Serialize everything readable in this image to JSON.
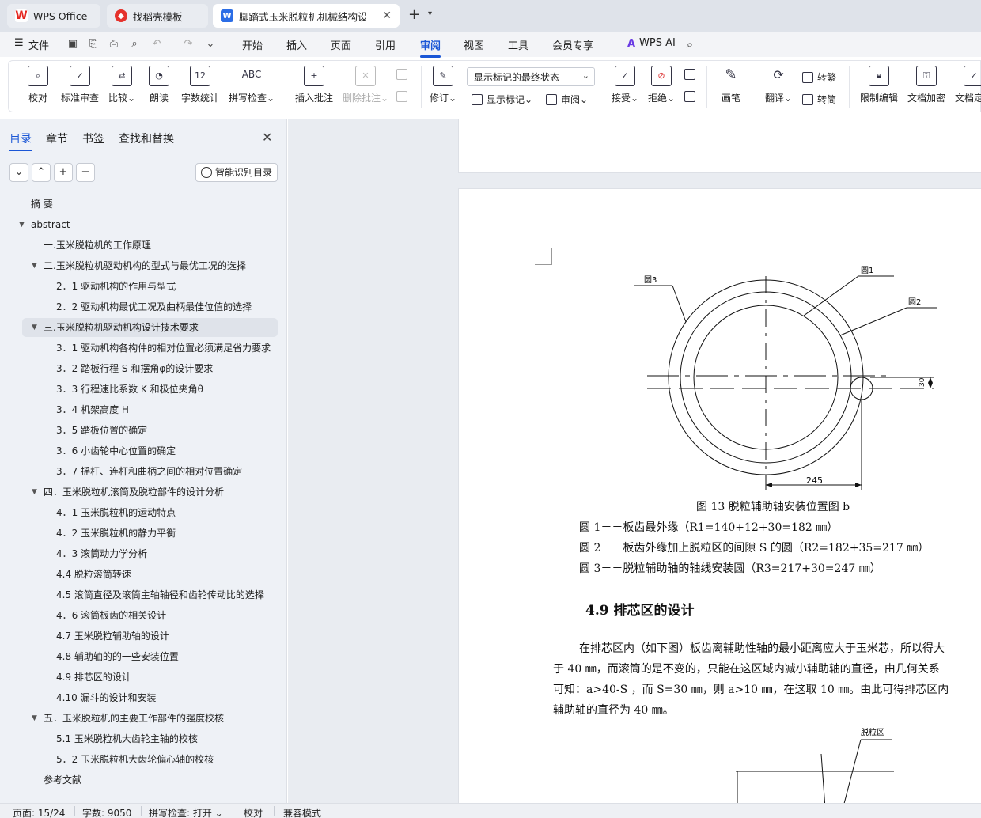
{
  "titlebar": {
    "tabs": [
      {
        "label": "WPS Office"
      },
      {
        "label": "找稻壳模板"
      },
      {
        "label": "脚踏式玉米脱粒机机械结构设计"
      }
    ],
    "new_tab": "+",
    "tab_list": "⌄"
  },
  "menubar": {
    "file": "文件",
    "items": [
      "开始",
      "插入",
      "页面",
      "引用",
      "审阅",
      "视图",
      "工具",
      "会员专享"
    ],
    "active": "审阅",
    "wps_ai": "WPS AI"
  },
  "ribbon": {
    "proofread": "校对",
    "std_review": "标准审查",
    "compare": "比较",
    "read_aloud": "朗读",
    "word_count": "字数统计",
    "spell_check": "拼写检查",
    "insert_comment": "插入批注",
    "delete_comment": "删除批注",
    "revise": "修订",
    "markup_state": "显示标记的最终状态",
    "show_markup": "显示标记",
    "review": "审阅",
    "accept": "接受",
    "reject": "拒绝",
    "pen": "画笔",
    "translate": "翻译",
    "to_traditional": "转繁",
    "to_simplified": "转简",
    "restrict_edit": "限制编辑",
    "doc_encrypt": "文档加密",
    "doc_final": "文档定稿",
    "word_count_icon_text": "12",
    "spell_icon_text": "ABC"
  },
  "nav": {
    "tabs": [
      "目录",
      "章节",
      "书签",
      "查找和替换"
    ],
    "ai_toc": "智能识别目录",
    "toc": [
      {
        "text": "摘  要",
        "level": 0,
        "arrow": ""
      },
      {
        "text": "abstract",
        "level": 0,
        "arrow": "▼"
      },
      {
        "text": "一.玉米脱粒机的工作原理",
        "level": 1,
        "arrow": ""
      },
      {
        "text": "二.玉米脱粒机驱动机构的型式与最优工况的选择",
        "level": 1,
        "arrow": "▼"
      },
      {
        "text": "2．1   驱动机构的作用与型式",
        "level": 2,
        "arrow": ""
      },
      {
        "text": "2．2   驱动机构最优工况及曲柄最佳位值的选择",
        "level": 2,
        "arrow": ""
      },
      {
        "text": "三.玉米脱粒机驱动机构设计技术要求",
        "level": 1,
        "arrow": "▼",
        "selected": true
      },
      {
        "text": "3．1   驱动机构各构件的相对位置必须满足省力要求",
        "level": 2,
        "arrow": ""
      },
      {
        "text": "3．2 踏板行程 S 和摆角φ的设计要求",
        "level": 2,
        "arrow": ""
      },
      {
        "text": "3．3 行程速比系数 K 和极位夹角θ",
        "level": 2,
        "arrow": ""
      },
      {
        "text": "3．4   机架高度 H",
        "level": 2,
        "arrow": ""
      },
      {
        "text": "3．5 踏板位置的确定",
        "level": 2,
        "arrow": ""
      },
      {
        "text": "3．6 小齿轮中心位置的确定",
        "level": 2,
        "arrow": ""
      },
      {
        "text": "3．7       摇杆、连杆和曲柄之间的相对位置确定",
        "level": 2,
        "arrow": ""
      },
      {
        "text": "四．玉米脱粒机滚筒及脱粒部件的设计分析",
        "level": 1,
        "arrow": "▼"
      },
      {
        "text": "4．1   玉米脱粒机的运动特点",
        "level": 2,
        "arrow": ""
      },
      {
        "text": "4．2 玉米脱粒机的静力平衡",
        "level": 2,
        "arrow": ""
      },
      {
        "text": "4．3   滚筒动力学分析",
        "level": 2,
        "arrow": ""
      },
      {
        "text": "4.4 脱粒滚筒转速",
        "level": 2,
        "arrow": ""
      },
      {
        "text": "4.5    滚筒直径及滚筒主轴轴径和齿轮传动比的选择",
        "level": 2,
        "arrow": ""
      },
      {
        "text": "4．6 滚筒板齿的相关设计",
        "level": 2,
        "arrow": ""
      },
      {
        "text": "4.7 玉米脱粒辅助轴的设计",
        "level": 2,
        "arrow": ""
      },
      {
        "text": "4.8 辅助轴的的一些安装位置",
        "level": 2,
        "arrow": ""
      },
      {
        "text": "4.9 排芯区的设计",
        "level": 2,
        "arrow": ""
      },
      {
        "text": "4.10 漏斗的设计和安装",
        "level": 2,
        "arrow": ""
      },
      {
        "text": "五．玉米脱粒机的主要工作部件的强度校核",
        "level": 1,
        "arrow": "▼"
      },
      {
        "text": "5.1 玉米脱粒机大齿轮主轴的校核",
        "level": 2,
        "arrow": ""
      },
      {
        "text": "5．2   玉米脱粒机大齿轮偏心轴的校核",
        "level": 2,
        "arrow": ""
      },
      {
        "text": "参考文献",
        "level": 1,
        "arrow": ""
      }
    ]
  },
  "document": {
    "fig_labels": {
      "c3": "圆3",
      "c1": "圆1",
      "c2": "圆2",
      "dim_245": "245",
      "dim_30": "30",
      "zone": "脱粒区"
    },
    "caption": "图 13   脱粒辅助轴安装位置图 b",
    "legend": [
      "圆 1－－板齿最外缘（R1=140+12+30=182 ㎜）",
      "圆 2－－板齿外缘加上脱粒区的间隙 S 的圆（R2=182+35=217 ㎜）",
      "圆 3－－脱粒辅助轴的轴线安装圆（R3=217+30=247 ㎜）"
    ],
    "heading": "4.9  排芯区的设计",
    "para": [
      "在排芯区内（如下图）板齿离辅助性轴的最小距离应大于玉米芯，所以得大",
      "于 40 ㎜，而滚筒的是不变的，只能在这区域内减小辅助轴的直径，由几何关系",
      "可知：a>40-S ，而      S=30 ㎜，则 a>10 ㎜，在这取 10 ㎜。由此可得排芯区内",
      "辅助轴的直径为 40 ㎜。"
    ]
  },
  "status": {
    "page": "页面: 15/24",
    "words": "字数: 9050",
    "spell": "拼写检查: 打开",
    "proof": "校对",
    "compat": "兼容模式"
  }
}
